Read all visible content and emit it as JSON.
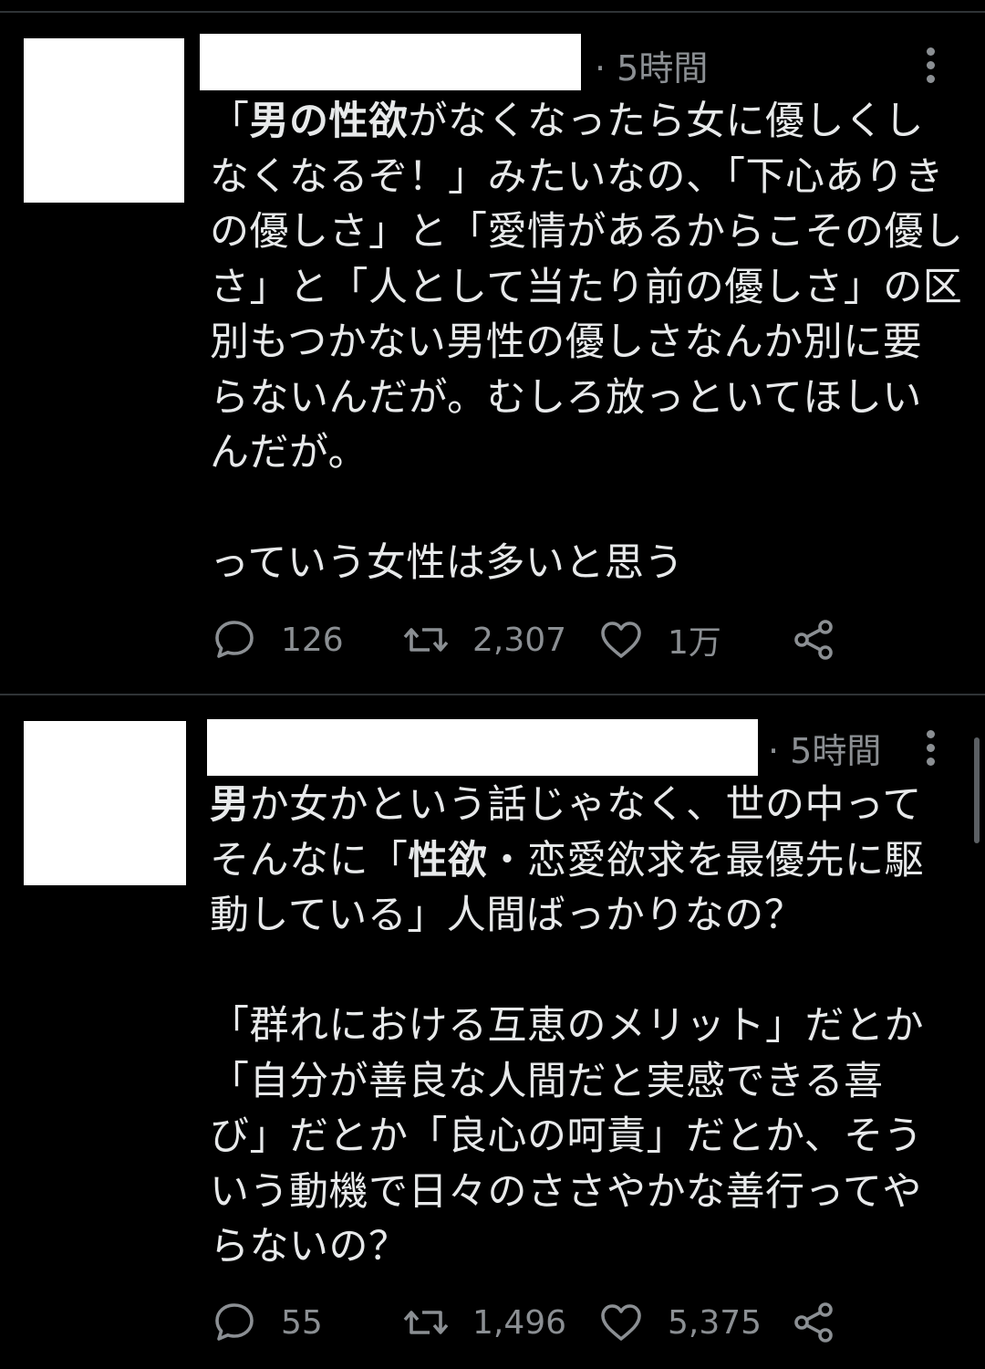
{
  "tweets": [
    {
      "time": "· 5時間",
      "body_lines": [
        [
          {
            "t": "「",
            "b": false
          },
          {
            "t": "男の性欲",
            "b": true
          },
          {
            "t": "がなくなったら女に優しくし",
            "b": false
          }
        ],
        [
          {
            "t": "なくなるぞ！」みたいなの、「下心ありき",
            "b": false
          }
        ],
        [
          {
            "t": "の優しさ」と「愛情があるからこその優し",
            "b": false
          }
        ],
        [
          {
            "t": "さ」と「人として当たり前の優しさ」の区",
            "b": false
          }
        ],
        [
          {
            "t": "別もつかない男性の優しさなんか別に要",
            "b": false
          }
        ],
        [
          {
            "t": "らないんだが。むしろ放っといてほしい",
            "b": false
          }
        ],
        [
          {
            "t": "んだが。",
            "b": false
          }
        ],
        [],
        [
          {
            "t": "っていう女性は多いと思う",
            "b": false
          }
        ]
      ],
      "replies": "126",
      "retweets": "2,307",
      "likes": "1万"
    },
    {
      "time": "· 5時間",
      "body_lines": [
        [
          {
            "t": "男",
            "b": true
          },
          {
            "t": "か女かという話じゃなく、世の中って",
            "b": false
          }
        ],
        [
          {
            "t": "そんなに「",
            "b": false
          },
          {
            "t": "性欲",
            "b": true
          },
          {
            "t": "・恋愛欲求を最優先に駆",
            "b": false
          }
        ],
        [
          {
            "t": "動している」人間ばっかりなの？",
            "b": false
          }
        ],
        [],
        [
          {
            "t": "「群れにおける互恵のメリット」だとか",
            "b": false
          }
        ],
        [
          {
            "t": "「自分が善良な人間だと実感できる喜",
            "b": false
          }
        ],
        [
          {
            "t": "び」だとか「良心の呵責」だとか、そう",
            "b": false
          }
        ],
        [
          {
            "t": "いう動機で日々のささやかな善行ってや",
            "b": false
          }
        ],
        [
          {
            "t": "らないの？",
            "b": false
          }
        ]
      ],
      "replies": "55",
      "retweets": "1,496",
      "likes": "5,375"
    }
  ],
  "colors": {
    "background": "#000000",
    "text": "#e7e9ea",
    "secondary": "#8b8f93",
    "divider": "#2f3336",
    "redaction": "#ffffff"
  },
  "icons": {
    "reply": "speech-bubble-icon",
    "retweet": "retweet-icon",
    "like": "heart-icon",
    "share": "share-icon",
    "more": "more-vertical-icon"
  }
}
